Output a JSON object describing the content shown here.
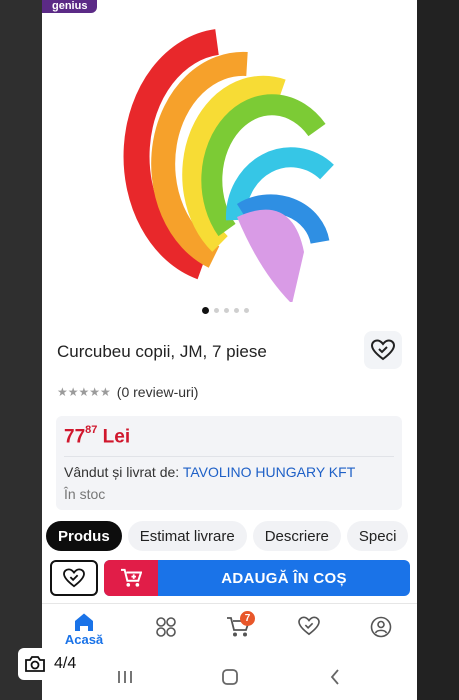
{
  "badge": "genius",
  "product": {
    "title": "Curcubeu copii, JM, 7 piese",
    "reviews": "(0 review-uri)",
    "price_int": "77",
    "price_dec": "87",
    "currency": "Lei",
    "seller_prefix": "Vândut și livrat de:",
    "seller_name": "TAVOLINO HUNGARY KFT",
    "stock": "În stoc",
    "image_count": 5,
    "image_active": 0
  },
  "tabs": [
    "Produs",
    "Estimat livrare",
    "Descriere",
    "Speci"
  ],
  "actions": {
    "add_to_cart": "ADAUGĂ ÎN COȘ"
  },
  "nav": {
    "home_label": "Acasă",
    "cart_count": "7"
  },
  "gallery_counter": "4/4",
  "colors": {
    "accent": "#1a73e8",
    "price": "#d0172d",
    "cart_red": "#e11d48",
    "badge": "#5b2a86",
    "rainbow": [
      "#e8282b",
      "#f6a12b",
      "#f7dc35",
      "#7ccb35",
      "#36c6e6",
      "#2f8fe3",
      "#d99be6"
    ]
  }
}
